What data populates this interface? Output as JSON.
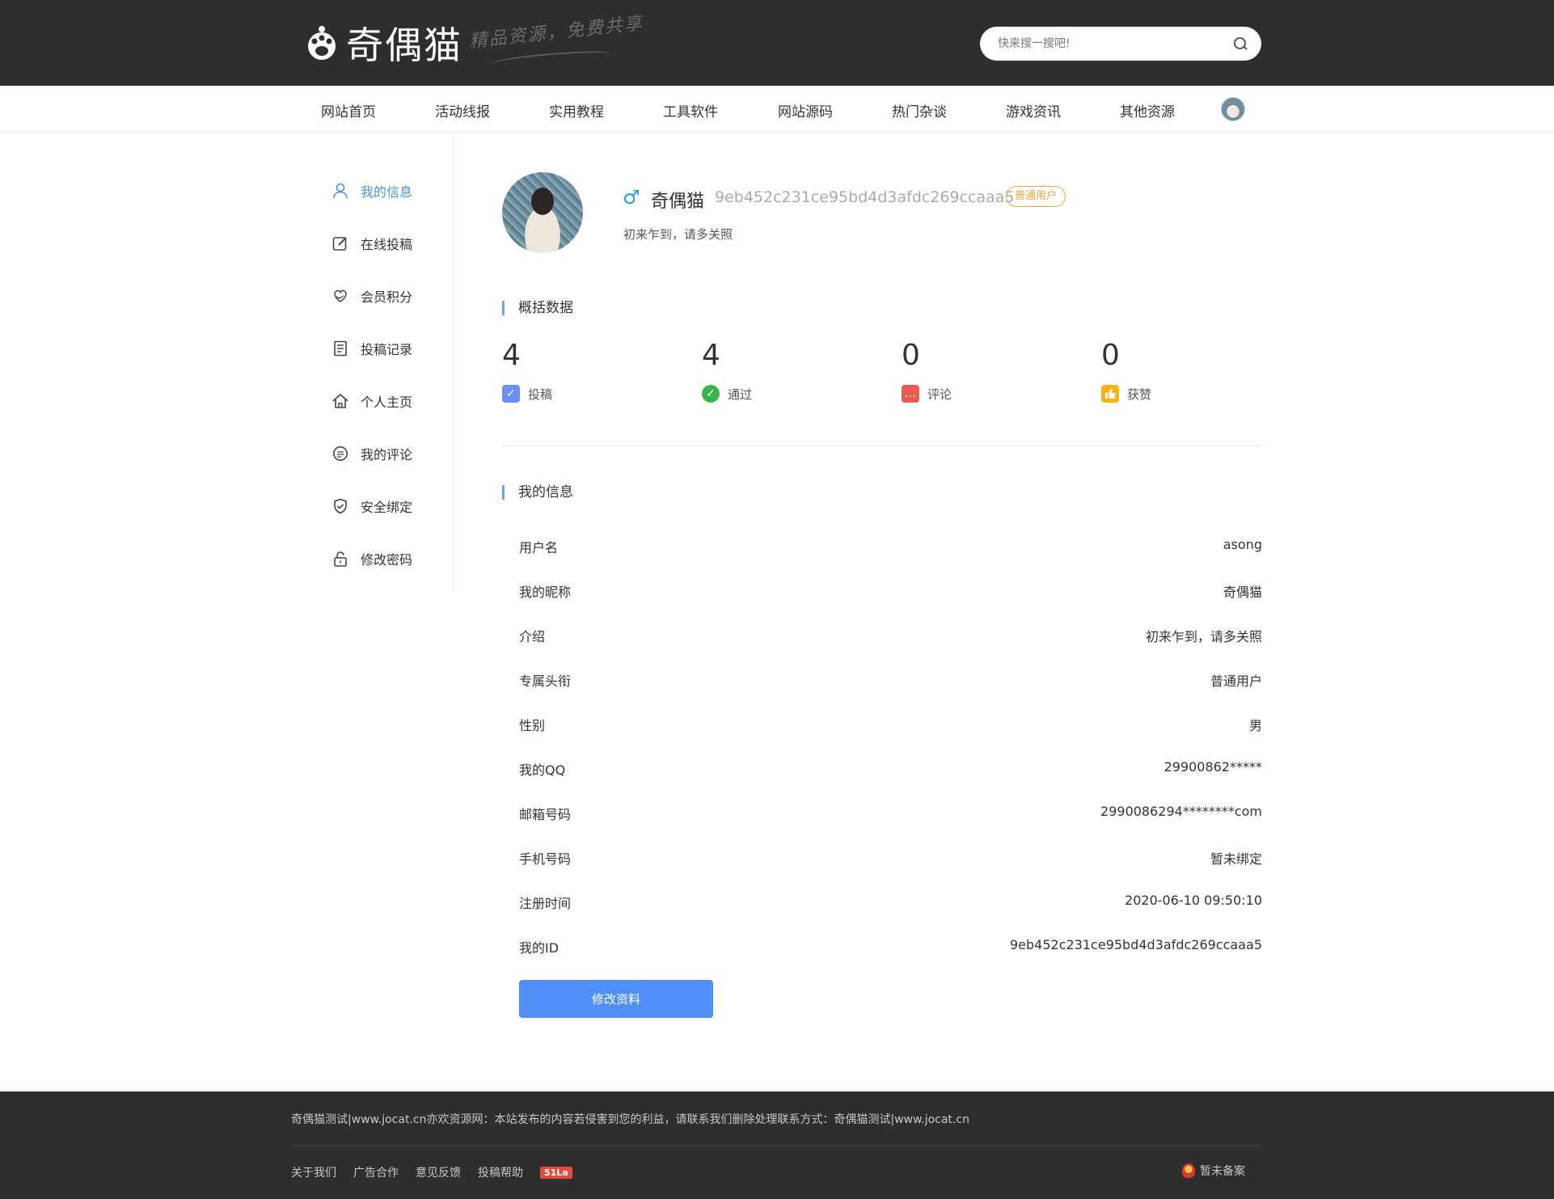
{
  "header": {
    "logo_text": "奇偶猫",
    "slogan": "精品资源，免费共享",
    "search_placeholder": "快来搜一搜吧!"
  },
  "nav": {
    "items": [
      "网站首页",
      "活动线报",
      "实用教程",
      "工具软件",
      "网站源码",
      "热门杂谈",
      "游戏资讯",
      "其他资源"
    ]
  },
  "sidebar": {
    "items": [
      {
        "label": "我的信息",
        "icon": "user-icon",
        "active": true
      },
      {
        "label": "在线投稿",
        "icon": "edit-icon"
      },
      {
        "label": "会员积分",
        "icon": "heart-hand-icon"
      },
      {
        "label": "投稿记录",
        "icon": "document-icon"
      },
      {
        "label": "个人主页",
        "icon": "home-icon"
      },
      {
        "label": "我的评论",
        "icon": "comment-icon"
      },
      {
        "label": "安全绑定",
        "icon": "shield-check-icon"
      },
      {
        "label": "修改密码",
        "icon": "lock-icon"
      }
    ]
  },
  "profile": {
    "gender_symbol": "♂",
    "name": "奇偶猫",
    "id": "9eb452c231ce95bd4d3afdc269ccaaa5",
    "role": "普通用户",
    "bio": "初来乍到，请多关照"
  },
  "overview": {
    "title": "概括数据",
    "stats": [
      {
        "value": "4",
        "label": "投稿",
        "icon": "submission-icon",
        "color": "#6d8ff5"
      },
      {
        "value": "4",
        "label": "通过",
        "icon": "check-circle-icon",
        "color": "#3ab54a"
      },
      {
        "value": "0",
        "label": "评论",
        "icon": "comment-box-icon",
        "color": "#e95a4f"
      },
      {
        "value": "0",
        "label": "获赞",
        "icon": "thumbs-up-icon",
        "color": "#f5b316"
      }
    ]
  },
  "info": {
    "title": "我的信息",
    "rows": [
      {
        "key": "用户名",
        "value": "asong"
      },
      {
        "key": "我的昵称",
        "value": "奇偶猫"
      },
      {
        "key": "介绍",
        "value": "初来乍到，请多关照"
      },
      {
        "key": "专属头衔",
        "value": "普通用户"
      },
      {
        "key": "性别",
        "value": "男"
      },
      {
        "key": "我的QQ",
        "value": "29900862*****"
      },
      {
        "key": "邮箱号码",
        "value": "2990086294********com"
      },
      {
        "key": "手机号码",
        "value": "暂未绑定"
      },
      {
        "key": "注册时间",
        "value": "2020-06-10 09:50:10"
      },
      {
        "key": "我的ID",
        "value": "9eb452c231ce95bd4d3afdc269ccaaa5"
      }
    ],
    "edit_button": "修改资料"
  },
  "footer": {
    "text": "奇偶猫测试|www.jocat.cn亦欢资源网：本站发布的内容若侵害到您的利益，请联系我们删除处理联系方式：奇偶猫测试|www.jocat.cn",
    "links": [
      "关于我们",
      "广告合作",
      "意见反馈",
      "投稿帮助"
    ],
    "badge": "51La",
    "icp": "暂未备案"
  }
}
